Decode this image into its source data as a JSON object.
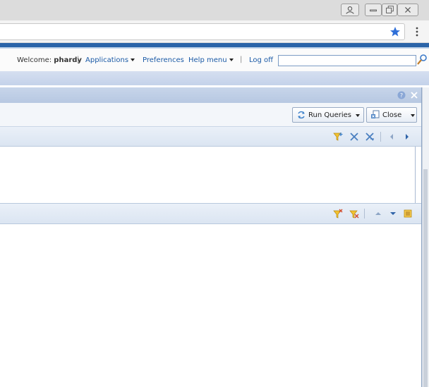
{
  "window": {
    "controls": [
      "user-icon",
      "minimize-icon",
      "restore-icon",
      "close-icon"
    ]
  },
  "browser": {
    "url_value": "",
    "bookmark_icon": "star-icon",
    "menu_icon": "kebab-menu-icon"
  },
  "header": {
    "welcome_prefix": "Welcome: ",
    "username": "phardy",
    "separator": "|",
    "applications_label": "Applications",
    "preferences_label": "Preferences",
    "help_menu_label": "Help menu",
    "logoff_label": "Log off",
    "search_value": ""
  },
  "panel": {
    "run_queries_label": "Run Queries",
    "close_label": "Close"
  },
  "colors": {
    "accent": "#2b64a8",
    "link": "#1b5aa6",
    "panel_header": "#c7d5ea"
  }
}
